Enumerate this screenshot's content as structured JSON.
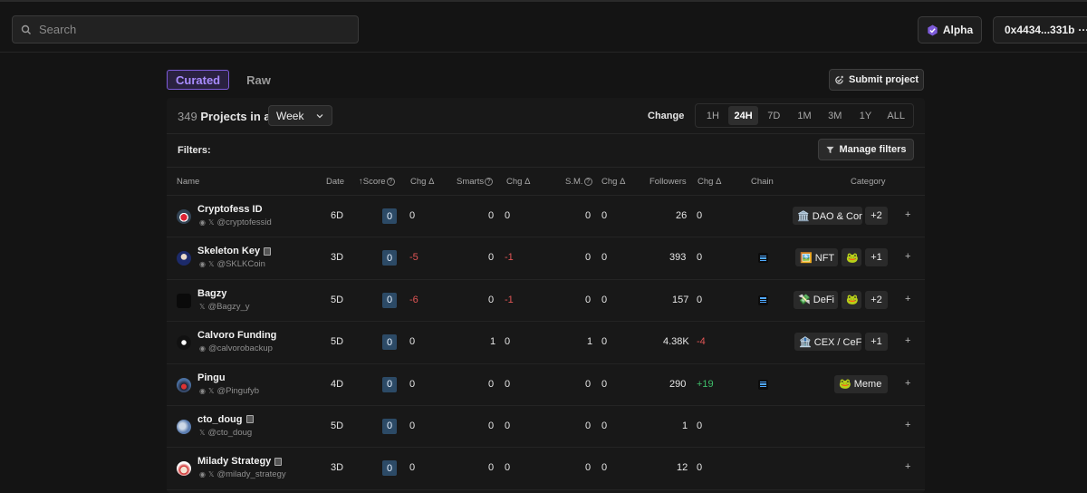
{
  "search": {
    "placeholder": "Search"
  },
  "header": {
    "alpha_label": "Alpha",
    "wallet_label": "0x4434...331b",
    "wallet_more": "···"
  },
  "tabs": [
    {
      "label": "Curated",
      "active": true
    },
    {
      "label": "Raw",
      "active": false
    }
  ],
  "submit_label": "Submit project",
  "summary": {
    "count": "349",
    "text": "Projects in a",
    "period": "Week"
  },
  "change": {
    "label": "Change",
    "ranges": [
      "1H",
      "24H",
      "7D",
      "1M",
      "3M",
      "1Y",
      "ALL"
    ],
    "active": "24H"
  },
  "filters": {
    "label": "Filters:",
    "manage_label": "Manage filters"
  },
  "columns": {
    "name": "Name",
    "date": "Date",
    "score": "Score",
    "chg1": "Chg Δ",
    "smarts": "Smarts",
    "chg2": "Chg Δ",
    "sm": "S.M.",
    "chg3": "Chg Δ",
    "followers": "Followers",
    "chg4": "Chg Δ",
    "chain": "Chain",
    "category": "Category"
  },
  "rows": [
    {
      "name": "Cryptofess ID",
      "handle": "@cryptofessid",
      "date": "6D",
      "score": "0",
      "score_chg": "0",
      "smarts": "0",
      "smarts_chg": "0",
      "sm": "0",
      "sm_chg": "0",
      "followers": "26",
      "followers_chg": "0",
      "chain": "",
      "category": "🏛️ DAO & Con",
      "extra": "+2"
    },
    {
      "name": "Skeleton Key",
      "handle": "@SKLKCoin",
      "date": "3D",
      "score": "0",
      "score_chg": "-5",
      "smarts": "0",
      "smarts_chg": "-1",
      "sm": "0",
      "sm_chg": "0",
      "followers": "393",
      "followers_chg": "0",
      "chain": "solana",
      "category": "🖼️ NFT",
      "category2": "🐸",
      "extra": "+1"
    },
    {
      "name": "Bagzy",
      "handle": "@Bagzy_y",
      "date": "5D",
      "score": "0",
      "score_chg": "-6",
      "smarts": "0",
      "smarts_chg": "-1",
      "sm": "0",
      "sm_chg": "0",
      "followers": "157",
      "followers_chg": "0",
      "chain": "solana",
      "category": "💸 DeFi",
      "category2": "🐸",
      "extra": "+2"
    },
    {
      "name": "Calvoro Funding",
      "handle": "@calvorobackup",
      "date": "5D",
      "score": "0",
      "score_chg": "0",
      "smarts": "1",
      "smarts_chg": "0",
      "sm": "1",
      "sm_chg": "0",
      "followers": "4.38K",
      "followers_chg": "-4",
      "chain": "",
      "category": "🏦 CEX / CeFi",
      "extra": "+1"
    },
    {
      "name": "Pingu",
      "handle": "@Pingufyb",
      "date": "4D",
      "score": "0",
      "score_chg": "0",
      "smarts": "0",
      "smarts_chg": "0",
      "sm": "0",
      "sm_chg": "0",
      "followers": "290",
      "followers_chg": "+19",
      "chain": "solana",
      "category": "🐸 Meme",
      "extra": ""
    },
    {
      "name": "cto_doug",
      "handle": "@cto_doug",
      "date": "5D",
      "score": "0",
      "score_chg": "0",
      "smarts": "0",
      "smarts_chg": "0",
      "sm": "0",
      "sm_chg": "0",
      "followers": "1",
      "followers_chg": "0",
      "chain": "",
      "category": "",
      "extra": ""
    },
    {
      "name": "Milady Strategy",
      "handle": "@milady_strategy",
      "date": "3D",
      "score": "0",
      "score_chg": "0",
      "smarts": "0",
      "smarts_chg": "0",
      "sm": "0",
      "sm_chg": "0",
      "followers": "12",
      "followers_chg": "0",
      "chain": "",
      "category": "",
      "extra": ""
    }
  ],
  "colors": {
    "accent": "#7d5bd9",
    "negative": "#e05555",
    "positive": "#3fbf6a",
    "score_bg": "#2c4a66"
  }
}
